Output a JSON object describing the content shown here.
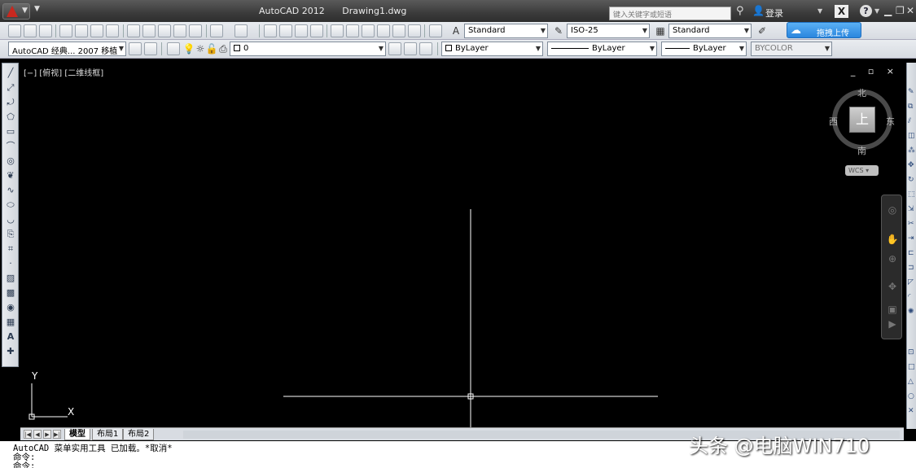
{
  "window": {
    "app_name": "AutoCAD 2012",
    "document_name": "Drawing1.dwg"
  },
  "titlebar": {
    "search_placeholder": "键入关键字或短语",
    "login_label": "登录",
    "help_label": "?",
    "exchange_label": "X"
  },
  "toolbar": {
    "text_style": "Standard",
    "dim_style": "ISO-25",
    "table_style": "Standard",
    "cloud_upload_label": "拖拽上传"
  },
  "toolbar2": {
    "workspace": "AutoCAD 经典... 2007 移植",
    "layer_name": "0",
    "color": "ByLayer",
    "linetype": "ByLayer",
    "lineweight": "ByLayer",
    "plot_style": "BYCOLOR"
  },
  "viewport": {
    "label": "[−] [俯视] [二维线框]",
    "controls": "_ ▫ ×",
    "viewcube": {
      "north": "北",
      "south": "南",
      "east": "东",
      "west": "西",
      "top_face": "上",
      "wcs_label": "WCS ▾"
    },
    "ucs_x": "X",
    "ucs_y": "Y"
  },
  "layout_tabs": [
    {
      "label": "模型",
      "active": true
    },
    {
      "label": "布局1",
      "active": false
    },
    {
      "label": "布局2",
      "active": false
    }
  ],
  "command_lines": [
    "AutoCAD 菜单实用工具 已加载。*取消*",
    "命令:",
    "命令:"
  ],
  "watermark": "头条 @电脑WIN710",
  "colors": {
    "canvas": "#000000",
    "crosshair": "#ffffff",
    "cloud_button": "#2a86de"
  }
}
